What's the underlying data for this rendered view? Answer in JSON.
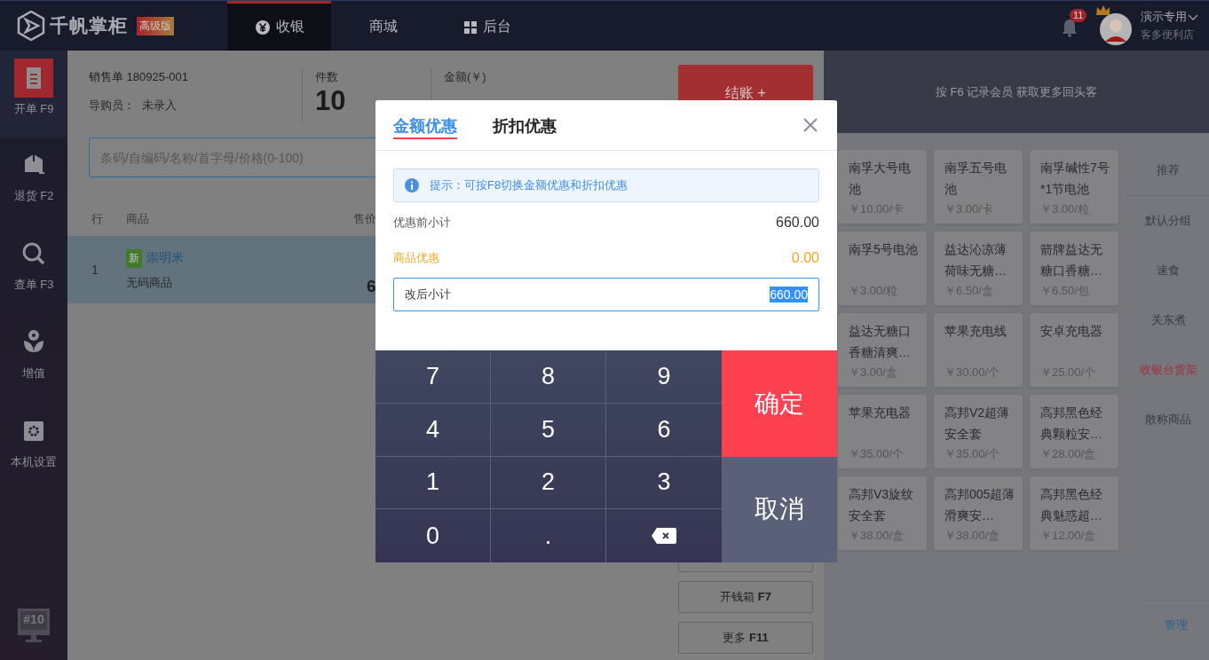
{
  "topbar": {
    "brand": "千帆掌柜",
    "edition": "高级版",
    "tabs": [
      {
        "label": "收银",
        "selected": true
      },
      {
        "label": "商城",
        "selected": false
      },
      {
        "label": "后台",
        "selected": false
      }
    ],
    "notifications": "11",
    "user": {
      "name": "演示专用",
      "store": "客多便利店"
    }
  },
  "sidebar": {
    "items": [
      {
        "label": "开单 F9",
        "selected": true
      },
      {
        "label": "退货 F2",
        "selected": false
      },
      {
        "label": "查单 F3",
        "selected": false
      },
      {
        "label": "增值",
        "selected": false
      },
      {
        "label": "本机设置",
        "selected": false
      }
    ],
    "terminal": "#10"
  },
  "order": {
    "number": "销售单 180925-001",
    "guide_label": "导购员：",
    "guide_value": "未录入",
    "count_label": "件数",
    "count": "10",
    "amount_label": "金额(￥)"
  },
  "checkout_button": "结账 +",
  "search": {
    "placeholder": "条码/自编码/名称/首字母/价格(0-100)"
  },
  "table": {
    "columns": [
      "行",
      "商品",
      "售价"
    ],
    "rows": [
      {
        "index": "1",
        "badge": "新",
        "name": "崇明米",
        "code": "无码商品",
        "price": "6",
        "selected": true
      }
    ]
  },
  "side_buttons": [
    {
      "label": "开钱箱",
      "key": "F7"
    },
    {
      "label": "更多",
      "key": "F11"
    }
  ],
  "member_banner": "按 F6 记录会员 获取更多回头客",
  "products": [
    {
      "name": "南孚大号电池",
      "price": "￥10.00/卡"
    },
    {
      "name": "南孚五号电池",
      "price": "￥3.00/卡"
    },
    {
      "name": "南孚碱性7号*1节电池",
      "price": "￥3.00/粒"
    },
    {
      "name": "南孚5号电池",
      "price": "￥3.00/粒"
    },
    {
      "name": "益达沁凉薄荷味无糖…",
      "price": "￥6.50/盒"
    },
    {
      "name": "箭牌益达无糖口香糖…",
      "price": "￥6.50/包"
    },
    {
      "name": "益达无糖口香糖清爽…",
      "price": "￥3.00/盒"
    },
    {
      "name": "苹果充电线",
      "price": "￥30.00/个"
    },
    {
      "name": "安卓充电器",
      "price": "￥25.00/个"
    },
    {
      "name": "苹果充电器",
      "price": "￥35.00/个"
    },
    {
      "name": "高邦V2超薄安全套",
      "price": "￥35.00/个"
    },
    {
      "name": "高邦黑色经典颗粒安…",
      "price": "￥28.00/盒"
    },
    {
      "name": "高邦V3旋纹安全套",
      "price": "￥38.00/盒"
    },
    {
      "name": "高邦005超薄滑爽安…",
      "price": "￥38.00/盒"
    },
    {
      "name": "高邦黑色经典魅惑超…",
      "price": "￥12.00/盒"
    }
  ],
  "categories": [
    {
      "label": "推荐",
      "selected": false
    },
    {
      "label": "默认分组",
      "selected": false
    },
    {
      "label": "速食",
      "selected": false
    },
    {
      "label": "关东煮",
      "selected": false
    },
    {
      "label": "收银台货架",
      "selected": true
    },
    {
      "label": "散称商品",
      "selected": false
    }
  ],
  "manage_link": "管理",
  "dialog": {
    "tabs": [
      {
        "label": "金额优惠",
        "selected": true
      },
      {
        "label": "折扣优惠",
        "selected": false
      }
    ],
    "tip": "提示：可按F8切换金额优惠和折扣优惠",
    "rows": [
      {
        "label": "优惠前小计",
        "value": "660.00",
        "kind": "normal"
      },
      {
        "label": "商品优惠",
        "value": "0.00",
        "kind": "discount"
      }
    ],
    "input": {
      "label": "改后小计",
      "value": "660.00"
    },
    "keys": [
      {
        "kind": "digit",
        "label": "7"
      },
      {
        "kind": "digit",
        "label": "8"
      },
      {
        "kind": "digit",
        "label": "9"
      },
      {
        "kind": "digit",
        "label": "4"
      },
      {
        "kind": "digit",
        "label": "5"
      },
      {
        "kind": "digit",
        "label": "6"
      },
      {
        "kind": "digit",
        "label": "1"
      },
      {
        "kind": "digit",
        "label": "2"
      },
      {
        "kind": "digit",
        "label": "3"
      },
      {
        "kind": "digit",
        "label": "0"
      },
      {
        "kind": "digit",
        "label": "."
      },
      {
        "kind": "backspace"
      }
    ],
    "confirm": "确定",
    "cancel": "取消"
  }
}
